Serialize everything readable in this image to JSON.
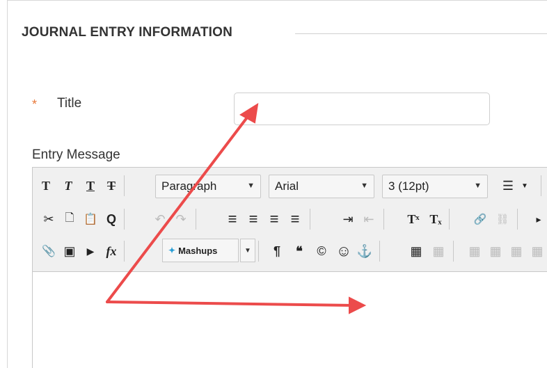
{
  "section": {
    "title": "JOURNAL ENTRY INFORMATION"
  },
  "title_field": {
    "required_mark": "*",
    "label": "Title",
    "value": ""
  },
  "entry_message": {
    "label": "Entry Message"
  },
  "toolbar": {
    "row1": {
      "bold": "T",
      "italic": "T",
      "underline": "T",
      "strike": "T",
      "format": "Paragraph",
      "font": "Arial",
      "size": "3 (12pt)",
      "list": "☰"
    },
    "row2": {
      "cut": "✂",
      "new_doc": "🗋",
      "paste": "📋",
      "find": "Q",
      "undo": "↶",
      "redo": "↷",
      "align_left": "≡",
      "align_center": "≡",
      "align_right": "≡",
      "justify": "≡",
      "indent": "⇥",
      "outdent": "⇤",
      "superscript": "Tˣ",
      "subscript": "Tₓ",
      "link": "🔗",
      "unlink": "⛓",
      "more": "▸"
    },
    "row3": {
      "attach": "📎",
      "image": "▣",
      "media": "▶",
      "math": "fx",
      "mashups": "Mashups",
      "pilcrow": "¶",
      "quote": "❝",
      "copyright": "©",
      "emoji": "☺",
      "anchor": "⚓",
      "table": "▦"
    }
  },
  "colors": {
    "required": "#e8793a",
    "annotation_arrow": "#ec4b4b"
  }
}
